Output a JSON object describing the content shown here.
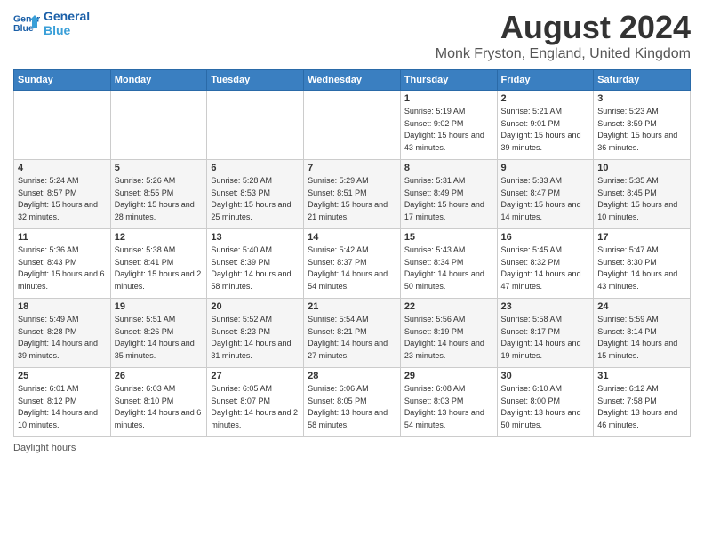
{
  "header": {
    "logo_line1": "General",
    "logo_line2": "Blue",
    "main_title": "August 2024",
    "subtitle": "Monk Fryston, England, United Kingdom"
  },
  "columns": [
    "Sunday",
    "Monday",
    "Tuesday",
    "Wednesday",
    "Thursday",
    "Friday",
    "Saturday"
  ],
  "weeks": [
    [
      {
        "day": "",
        "sunrise": "",
        "sunset": "",
        "daylight": ""
      },
      {
        "day": "",
        "sunrise": "",
        "sunset": "",
        "daylight": ""
      },
      {
        "day": "",
        "sunrise": "",
        "sunset": "",
        "daylight": ""
      },
      {
        "day": "",
        "sunrise": "",
        "sunset": "",
        "daylight": ""
      },
      {
        "day": "1",
        "sunrise": "Sunrise: 5:19 AM",
        "sunset": "Sunset: 9:02 PM",
        "daylight": "Daylight: 15 hours and 43 minutes."
      },
      {
        "day": "2",
        "sunrise": "Sunrise: 5:21 AM",
        "sunset": "Sunset: 9:01 PM",
        "daylight": "Daylight: 15 hours and 39 minutes."
      },
      {
        "day": "3",
        "sunrise": "Sunrise: 5:23 AM",
        "sunset": "Sunset: 8:59 PM",
        "daylight": "Daylight: 15 hours and 36 minutes."
      }
    ],
    [
      {
        "day": "4",
        "sunrise": "Sunrise: 5:24 AM",
        "sunset": "Sunset: 8:57 PM",
        "daylight": "Daylight: 15 hours and 32 minutes."
      },
      {
        "day": "5",
        "sunrise": "Sunrise: 5:26 AM",
        "sunset": "Sunset: 8:55 PM",
        "daylight": "Daylight: 15 hours and 28 minutes."
      },
      {
        "day": "6",
        "sunrise": "Sunrise: 5:28 AM",
        "sunset": "Sunset: 8:53 PM",
        "daylight": "Daylight: 15 hours and 25 minutes."
      },
      {
        "day": "7",
        "sunrise": "Sunrise: 5:29 AM",
        "sunset": "Sunset: 8:51 PM",
        "daylight": "Daylight: 15 hours and 21 minutes."
      },
      {
        "day": "8",
        "sunrise": "Sunrise: 5:31 AM",
        "sunset": "Sunset: 8:49 PM",
        "daylight": "Daylight: 15 hours and 17 minutes."
      },
      {
        "day": "9",
        "sunrise": "Sunrise: 5:33 AM",
        "sunset": "Sunset: 8:47 PM",
        "daylight": "Daylight: 15 hours and 14 minutes."
      },
      {
        "day": "10",
        "sunrise": "Sunrise: 5:35 AM",
        "sunset": "Sunset: 8:45 PM",
        "daylight": "Daylight: 15 hours and 10 minutes."
      }
    ],
    [
      {
        "day": "11",
        "sunrise": "Sunrise: 5:36 AM",
        "sunset": "Sunset: 8:43 PM",
        "daylight": "Daylight: 15 hours and 6 minutes."
      },
      {
        "day": "12",
        "sunrise": "Sunrise: 5:38 AM",
        "sunset": "Sunset: 8:41 PM",
        "daylight": "Daylight: 15 hours and 2 minutes."
      },
      {
        "day": "13",
        "sunrise": "Sunrise: 5:40 AM",
        "sunset": "Sunset: 8:39 PM",
        "daylight": "Daylight: 14 hours and 58 minutes."
      },
      {
        "day": "14",
        "sunrise": "Sunrise: 5:42 AM",
        "sunset": "Sunset: 8:37 PM",
        "daylight": "Daylight: 14 hours and 54 minutes."
      },
      {
        "day": "15",
        "sunrise": "Sunrise: 5:43 AM",
        "sunset": "Sunset: 8:34 PM",
        "daylight": "Daylight: 14 hours and 50 minutes."
      },
      {
        "day": "16",
        "sunrise": "Sunrise: 5:45 AM",
        "sunset": "Sunset: 8:32 PM",
        "daylight": "Daylight: 14 hours and 47 minutes."
      },
      {
        "day": "17",
        "sunrise": "Sunrise: 5:47 AM",
        "sunset": "Sunset: 8:30 PM",
        "daylight": "Daylight: 14 hours and 43 minutes."
      }
    ],
    [
      {
        "day": "18",
        "sunrise": "Sunrise: 5:49 AM",
        "sunset": "Sunset: 8:28 PM",
        "daylight": "Daylight: 14 hours and 39 minutes."
      },
      {
        "day": "19",
        "sunrise": "Sunrise: 5:51 AM",
        "sunset": "Sunset: 8:26 PM",
        "daylight": "Daylight: 14 hours and 35 minutes."
      },
      {
        "day": "20",
        "sunrise": "Sunrise: 5:52 AM",
        "sunset": "Sunset: 8:23 PM",
        "daylight": "Daylight: 14 hours and 31 minutes."
      },
      {
        "day": "21",
        "sunrise": "Sunrise: 5:54 AM",
        "sunset": "Sunset: 8:21 PM",
        "daylight": "Daylight: 14 hours and 27 minutes."
      },
      {
        "day": "22",
        "sunrise": "Sunrise: 5:56 AM",
        "sunset": "Sunset: 8:19 PM",
        "daylight": "Daylight: 14 hours and 23 minutes."
      },
      {
        "day": "23",
        "sunrise": "Sunrise: 5:58 AM",
        "sunset": "Sunset: 8:17 PM",
        "daylight": "Daylight: 14 hours and 19 minutes."
      },
      {
        "day": "24",
        "sunrise": "Sunrise: 5:59 AM",
        "sunset": "Sunset: 8:14 PM",
        "daylight": "Daylight: 14 hours and 15 minutes."
      }
    ],
    [
      {
        "day": "25",
        "sunrise": "Sunrise: 6:01 AM",
        "sunset": "Sunset: 8:12 PM",
        "daylight": "Daylight: 14 hours and 10 minutes."
      },
      {
        "day": "26",
        "sunrise": "Sunrise: 6:03 AM",
        "sunset": "Sunset: 8:10 PM",
        "daylight": "Daylight: 14 hours and 6 minutes."
      },
      {
        "day": "27",
        "sunrise": "Sunrise: 6:05 AM",
        "sunset": "Sunset: 8:07 PM",
        "daylight": "Daylight: 14 hours and 2 minutes."
      },
      {
        "day": "28",
        "sunrise": "Sunrise: 6:06 AM",
        "sunset": "Sunset: 8:05 PM",
        "daylight": "Daylight: 13 hours and 58 minutes."
      },
      {
        "day": "29",
        "sunrise": "Sunrise: 6:08 AM",
        "sunset": "Sunset: 8:03 PM",
        "daylight": "Daylight: 13 hours and 54 minutes."
      },
      {
        "day": "30",
        "sunrise": "Sunrise: 6:10 AM",
        "sunset": "Sunset: 8:00 PM",
        "daylight": "Daylight: 13 hours and 50 minutes."
      },
      {
        "day": "31",
        "sunrise": "Sunrise: 6:12 AM",
        "sunset": "Sunset: 7:58 PM",
        "daylight": "Daylight: 13 hours and 46 minutes."
      }
    ]
  ],
  "footer": {
    "daylight_label": "Daylight hours"
  }
}
